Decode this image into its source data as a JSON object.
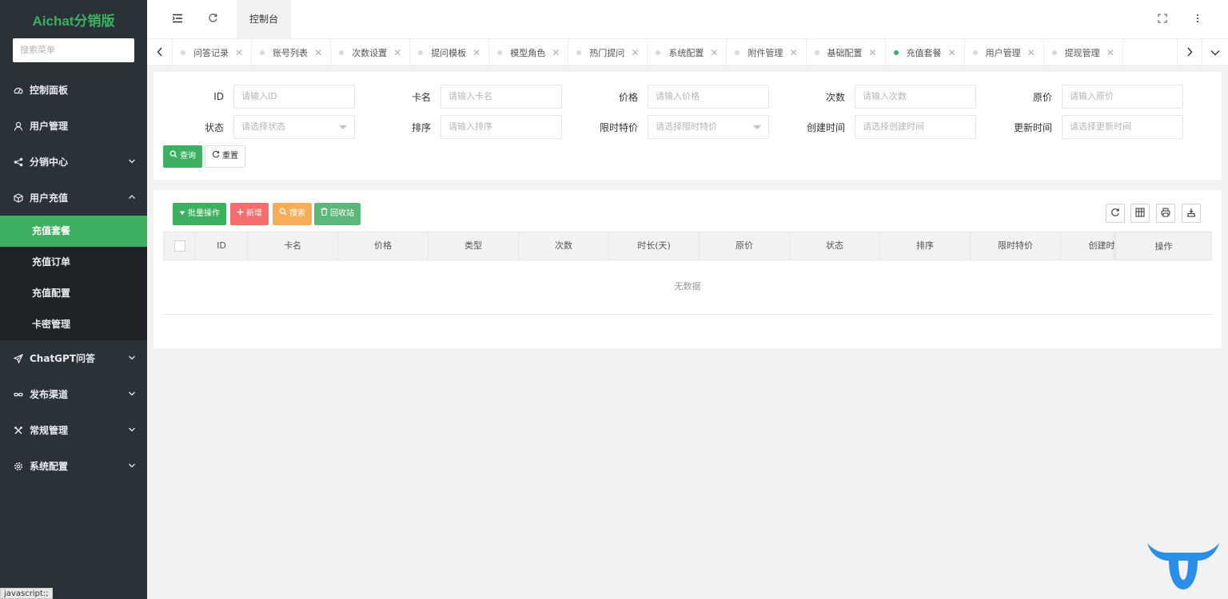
{
  "sidebar": {
    "logo": "Aichat分销版",
    "search_placeholder": "搜索菜单",
    "items": [
      {
        "label": "控制面板",
        "icon": "dashboard-icon"
      },
      {
        "label": "用户管理",
        "icon": "user-icon"
      },
      {
        "label": "分销中心",
        "icon": "share-icon"
      },
      {
        "label": "用户充值",
        "icon": "box-icon"
      },
      {
        "label": "ChatGPT问答",
        "icon": "send-icon"
      },
      {
        "label": "发布渠道",
        "icon": "infinity-icon"
      },
      {
        "label": "常规管理",
        "icon": "tools-icon"
      },
      {
        "label": "系统配置",
        "icon": "gear-icon"
      }
    ],
    "subitems": [
      "充值套餐",
      "充值订单",
      "充值配置",
      "卡密管理"
    ]
  },
  "status_bar": "javascript:;",
  "header": {
    "tab": "控制台"
  },
  "tabs": [
    "问答记录",
    "账号列表",
    "次数设置",
    "提问模板",
    "模型角色",
    "热门提问",
    "系统配置",
    "附件管理",
    "基础配置",
    "充值套餐",
    "用户管理",
    "提现管理"
  ],
  "active_tab": "充值套餐",
  "filters": {
    "row1": [
      {
        "label": "ID",
        "placeholder": "请输入ID"
      },
      {
        "label": "卡名",
        "placeholder": "请输入卡名"
      },
      {
        "label": "价格",
        "placeholder": "请输入价格"
      },
      {
        "label": "次数",
        "placeholder": "请输入次数"
      },
      {
        "label": "原价",
        "placeholder": "请输入原价"
      }
    ],
    "row2": [
      {
        "label": "状态",
        "placeholder": "请选择状态"
      },
      {
        "label": "排序",
        "placeholder": "请输入排序"
      },
      {
        "label": "限时特价",
        "placeholder": "请选择限时特价"
      },
      {
        "label": "创建时间",
        "placeholder": "请选择创建时间"
      },
      {
        "label": "更新时间",
        "placeholder": "请选择更新时间"
      }
    ],
    "query": "查询",
    "reset": "重置"
  },
  "toolbar": {
    "batch": "批量操作",
    "add": "新增",
    "search": "搜索",
    "recycle": "回收站"
  },
  "table": {
    "columns": [
      "ID",
      "卡名",
      "价格",
      "类型",
      "次数",
      "时长(天)",
      "原价",
      "状态",
      "排序",
      "限时特价",
      "创建时间"
    ],
    "action": "操作",
    "empty": "无数据"
  },
  "colors": {
    "accent": "#3cb060",
    "sidebar": "#2b3139",
    "danger": "#f56c6c",
    "warning": "#f6ad55"
  }
}
